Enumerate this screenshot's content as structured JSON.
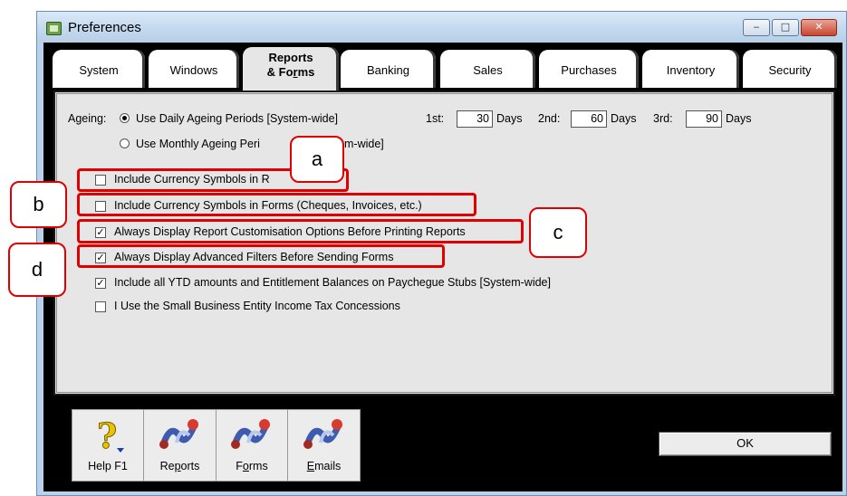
{
  "window": {
    "title": "Preferences",
    "controls": {
      "minimize": "‒",
      "maximize": "□",
      "close": "✕"
    }
  },
  "tabs": [
    {
      "label": "System"
    },
    {
      "label": "Windows"
    },
    {
      "label": "Reports & Forms",
      "active": true
    },
    {
      "label": "Banking"
    },
    {
      "label": "Sales"
    },
    {
      "label": "Purchases"
    },
    {
      "label": "Inventory"
    },
    {
      "label": "Security"
    }
  ],
  "ageing": {
    "label": "Ageing:",
    "daily_option": "Use Daily Ageing Periods [System-wide]",
    "daily_selected": true,
    "monthly_option_visible_start": "Use Monthly Ageing Peri",
    "monthly_option_visible_end": "m-wide]",
    "monthly_selected": false,
    "first_label": "1st:",
    "first_value": "30",
    "second_label": "2nd:",
    "second_value": "60",
    "third_label": "3rd:",
    "third_value": "90",
    "days_label": "Days"
  },
  "options": [
    {
      "label": "Include Currency Symbols in R",
      "checked": false
    },
    {
      "label": "Include Currency Symbols in Forms (Cheques, Invoices, etc.)",
      "checked": false
    },
    {
      "label": "Always Display Report Customisation Options Before Printing Reports",
      "checked": true
    },
    {
      "label": "Always Display Advanced Filters Before Sending Forms",
      "checked": true
    },
    {
      "label": "Include all YTD amounts and Entitlement Balances on Paychegue Stubs [System-wide]",
      "checked": true
    },
    {
      "label": "I Use the Small Business Entity Income Tax Concessions",
      "checked": false
    }
  ],
  "callouts": {
    "a": "a",
    "b": "b",
    "c": "c",
    "d": "d"
  },
  "callout_color": "#e00000",
  "toolbar": [
    {
      "label": "Help F1",
      "icon": "help-icon"
    },
    {
      "label": "Reports",
      "icon": "reports-icon"
    },
    {
      "label": "Forms",
      "icon": "forms-icon"
    },
    {
      "label": "Emails",
      "icon": "emails-icon"
    }
  ],
  "ok_label": "OK"
}
